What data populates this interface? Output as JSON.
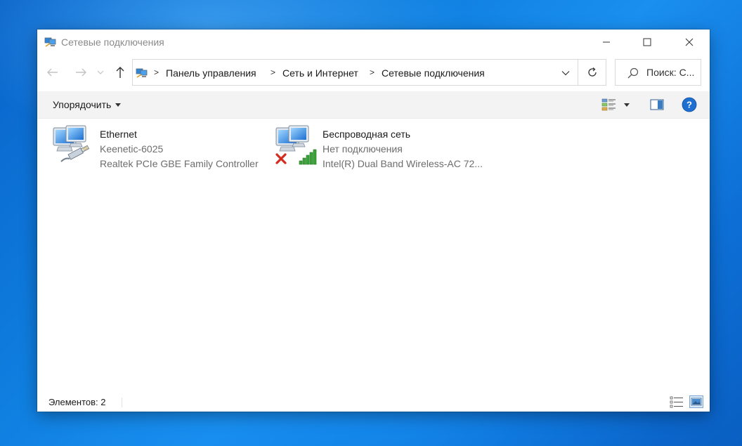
{
  "window": {
    "title": "Сетевые подключения"
  },
  "navigation": {
    "breadcrumbs": [
      {
        "label": "Панель управления"
      },
      {
        "label": "Сеть и Интернет"
      },
      {
        "label": "Сетевые подключения"
      }
    ],
    "search_placeholder": "Поиск: С..."
  },
  "toolbar": {
    "organize_label": "Упорядочить"
  },
  "connections": [
    {
      "name": "Ethernet",
      "network": "Keenetic-6025",
      "device": "Realtek PCIe GBE Family Controller",
      "icon": "ethernet-cable-icon"
    },
    {
      "name": "Беспроводная сеть",
      "status": "Нет подключения",
      "device": "Intel(R) Dual Band Wireless-AC 72...",
      "icon": "wifi-signal-icon"
    }
  ],
  "statusbar": {
    "item_count": "Элементов: 2"
  },
  "colors": {
    "desktop": "#0f7fe0",
    "help_blue": "#1e6fd0",
    "error_red": "#d42b1e",
    "signal_green": "#3aa63a"
  }
}
